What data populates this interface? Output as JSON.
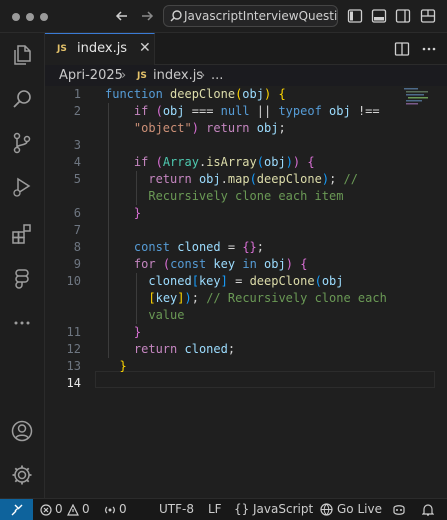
{
  "titlebar": {
    "search_text": "JavascriptInterviewQuestions"
  },
  "tab": {
    "badge": "JS",
    "filename": "index.js",
    "close_glyph": "✕"
  },
  "breadcrumb": {
    "folder": "Apri-2025",
    "separator": "›",
    "badge": "JS",
    "file": "index.js",
    "separator2": "›",
    "symbol": "..."
  },
  "editor": {
    "active_line": 14,
    "line_numbers": [
      "1",
      "2",
      "3",
      "4",
      "5",
      "6",
      "7",
      "8",
      "9",
      "10",
      "11",
      "12",
      "13",
      "14"
    ]
  },
  "statusbar": {
    "errors": "0",
    "warnings": "0",
    "ports": "0",
    "encoding": "UTF-8",
    "eol": "LF",
    "language_braces": "{}",
    "language": "JavaScript",
    "golive": "Go Live"
  },
  "icons": [
    "more-dots-icon",
    "back-arrow-icon",
    "forward-arrow-icon",
    "search-icon",
    "toggle-sidebar-icon",
    "toggle-panel-icon",
    "toggle-secondary-sidebar-icon",
    "layout-icon",
    "explorer-icon",
    "search-view-icon",
    "source-control-icon",
    "run-debug-icon",
    "extensions-icon",
    "figma-icon",
    "more-icon",
    "account-icon",
    "settings-icon",
    "split-editor-icon",
    "more-actions-icon",
    "remote-icon",
    "error-icon",
    "warning-icon",
    "ports-icon",
    "copilot-icon",
    "bell-icon",
    "go-live-icon"
  ],
  "colors": {
    "background": "#1f1f1f",
    "keyword": "#569cd6",
    "control_keyword": "#c586c0",
    "function": "#dcdcaa",
    "string": "#ce9178",
    "variable": "#9cdcfe",
    "type": "#4ec9b0",
    "comment": "#6a9955",
    "remote_accent": "#0e639c"
  }
}
